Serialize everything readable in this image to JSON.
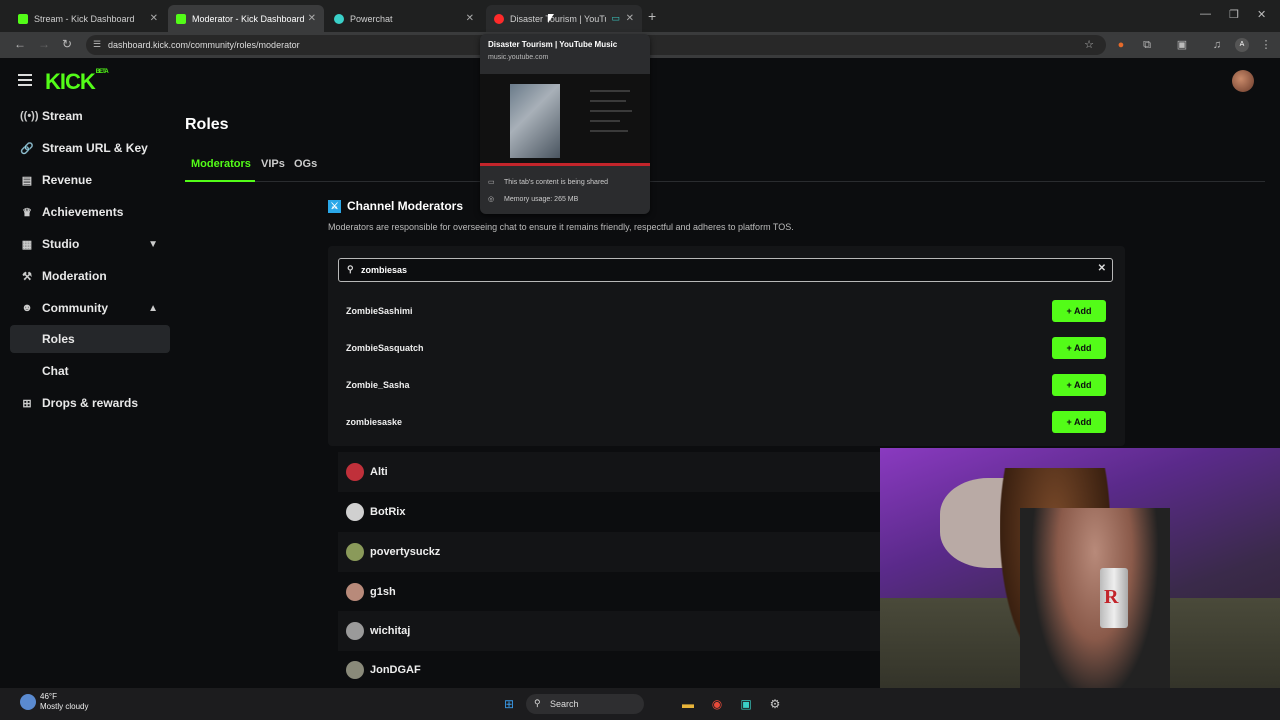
{
  "browser": {
    "tabs": [
      {
        "title": "Stream - Kick Dashboard",
        "favicon": "kick-icon",
        "color": "#53fc18"
      },
      {
        "title": "Moderator - Kick Dashboard",
        "favicon": "kick-icon",
        "color": "#53fc18"
      },
      {
        "title": "Powerchat",
        "favicon": "powerchat-icon",
        "color": "#3ad0c8"
      },
      {
        "title": "Disaster Tourism | YouTube",
        "favicon": "youtube-music-icon",
        "color": "#ff2a2a"
      }
    ],
    "url": "dashboard.kick.com/community/roles/moderator"
  },
  "tab_preview": {
    "title": "Disaster Tourism | YouTube Music",
    "domain": "music.youtube.com",
    "shared_note": "This tab's content is being shared",
    "memory": "Memory usage: 265 MB"
  },
  "sidebar": {
    "logo": "KICK",
    "logo_badge": "BETA",
    "items": [
      {
        "label": "Stream",
        "icon": "broadcast-icon"
      },
      {
        "label": "Stream URL & Key",
        "icon": "link-icon"
      },
      {
        "label": "Revenue",
        "icon": "money-icon"
      },
      {
        "label": "Achievements",
        "icon": "trophy-icon"
      },
      {
        "label": "Studio",
        "icon": "grid-icon"
      },
      {
        "label": "Moderation",
        "icon": "hammer-icon"
      },
      {
        "label": "Community",
        "icon": "people-icon"
      },
      {
        "label": "Roles"
      },
      {
        "label": "Chat"
      },
      {
        "label": "Drops & rewards",
        "icon": "gift-icon"
      }
    ]
  },
  "main": {
    "title": "Roles",
    "tabs": [
      "Moderators",
      "VIPs",
      "OGs"
    ],
    "section_title": "Channel Moderators",
    "section_desc": "Moderators are responsible for overseeing chat to ensure it remains friendly, respectful and adheres to platform TOS.",
    "search_value": "zombiesas",
    "results": [
      "ZombieSashimi",
      "ZombieSasquatch",
      "Zombie_Sasha",
      "zombiesaske"
    ],
    "add_label": "+ Add",
    "moderators": [
      {
        "name": "Alti",
        "color": "#c0303a"
      },
      {
        "name": "BotRix",
        "color": "#d0d0d0"
      },
      {
        "name": "povertysuckz",
        "color": "#8a9a5a"
      },
      {
        "name": "g1sh",
        "color": "#b88a7a"
      },
      {
        "name": "wichitaj",
        "color": "#9a9a9a"
      },
      {
        "name": "JonDGAF",
        "color": "#8a8a7a"
      }
    ]
  },
  "taskbar": {
    "temp": "46°F",
    "weather": "Mostly cloudy",
    "search": "Search"
  },
  "colors": {
    "accent": "#53fc18",
    "background": "#0c0d0f"
  }
}
